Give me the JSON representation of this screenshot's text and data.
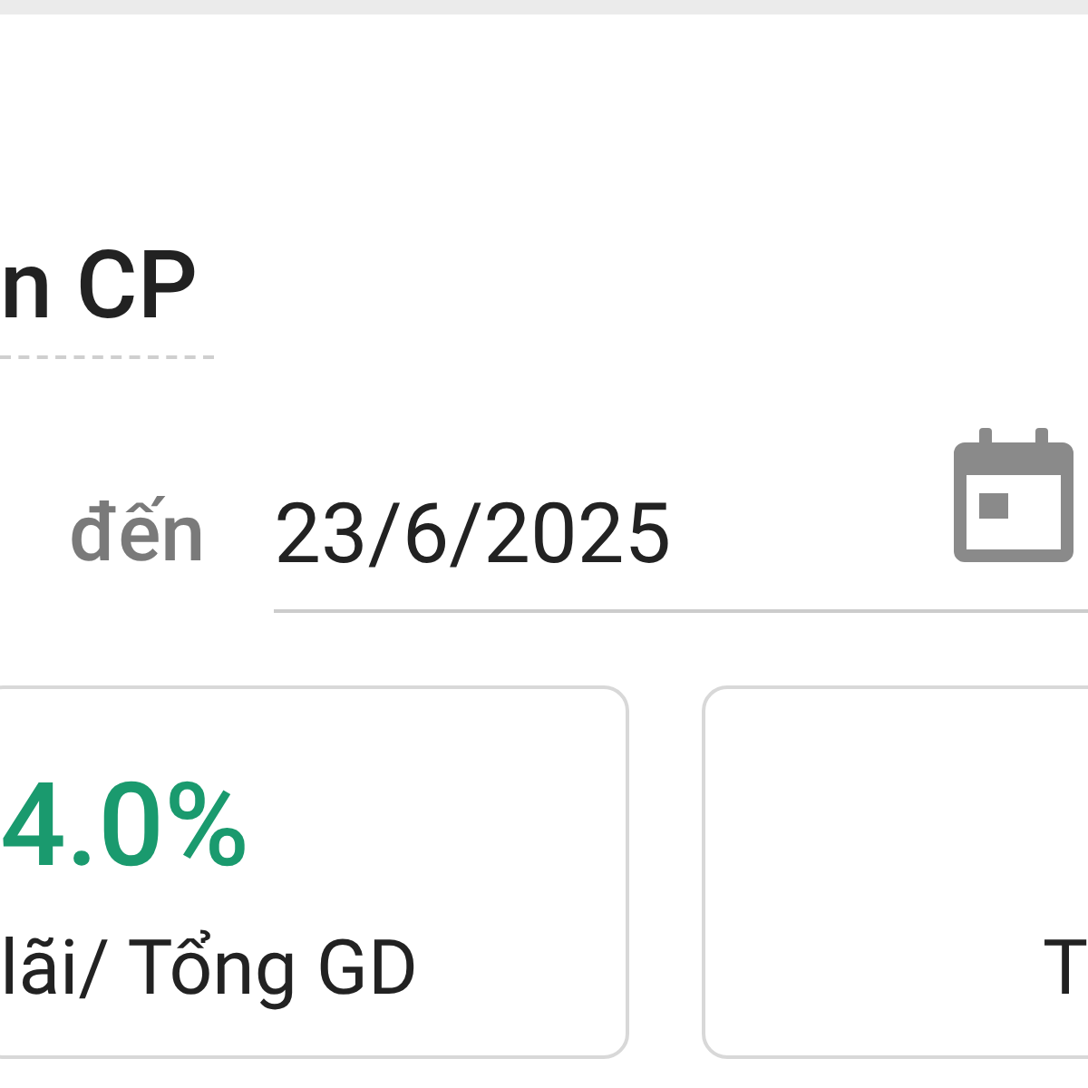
{
  "title": "n CP",
  "date_range": {
    "to_label": "đến",
    "to_value": "23/6/2025"
  },
  "cards": [
    {
      "value": "4.0%",
      "label": "lãi/ Tổng GD"
    },
    {
      "label": "T"
    }
  ]
}
